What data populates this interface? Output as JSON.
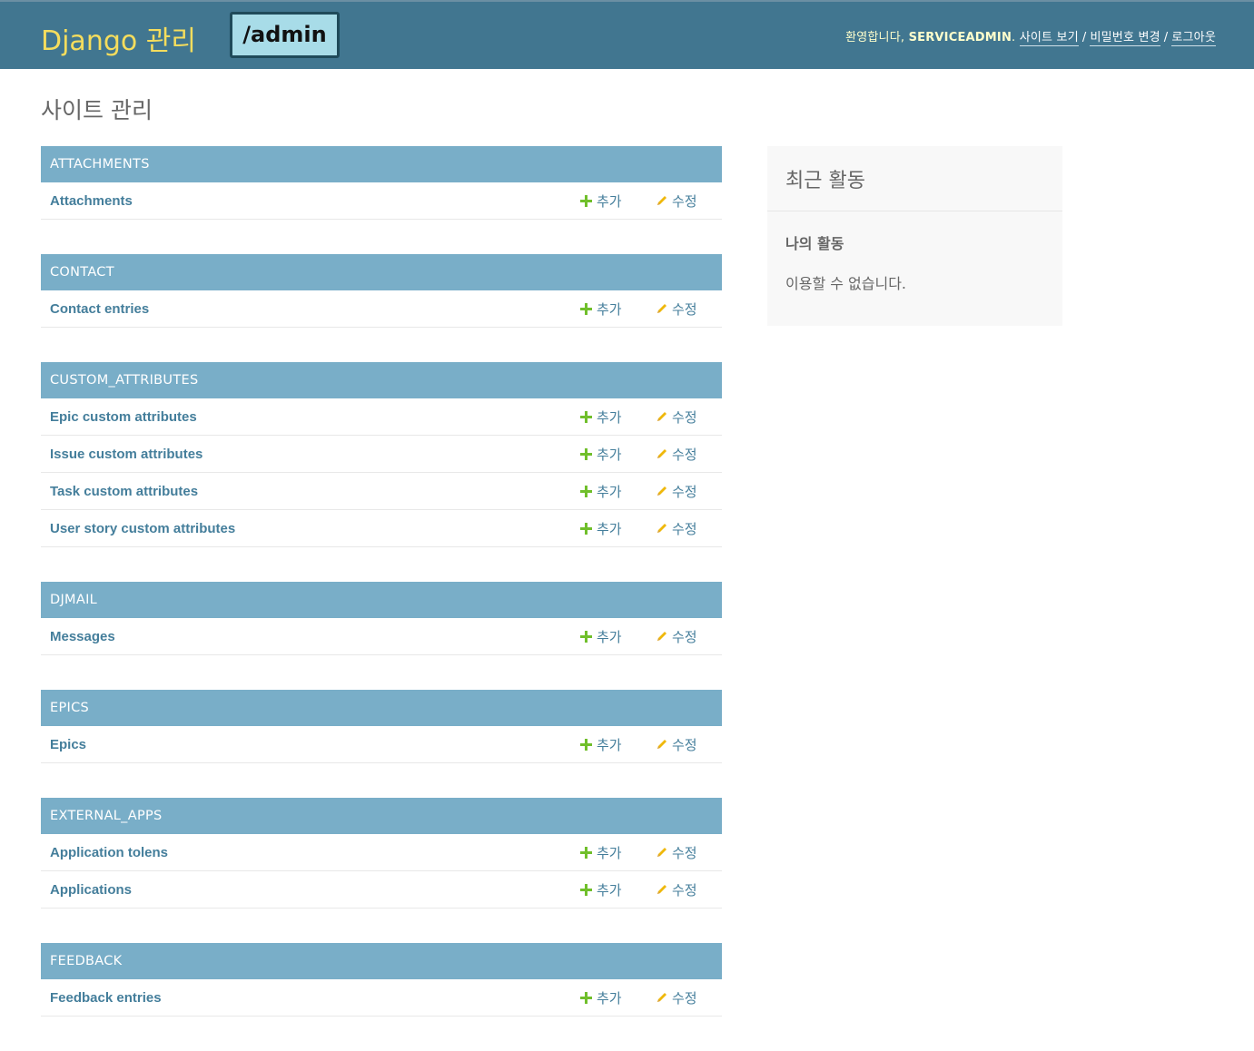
{
  "header": {
    "branding": "Django 관리",
    "annotation_tag": "/admin",
    "user_tools": {
      "welcome": "환영합니다,",
      "username": "SERVICEADMIN",
      "username_suffix": ".",
      "view_site": "사이트 보기",
      "change_password": "비밀번호 변경",
      "logout": "로그아웃",
      "separator": "/"
    }
  },
  "page_title": "사이트 관리",
  "labels": {
    "add": "추가",
    "change": "수정"
  },
  "modules": [
    {
      "caption": "ATTACHMENTS",
      "models": [
        "Attachments"
      ]
    },
    {
      "caption": "CONTACT",
      "models": [
        "Contact entries"
      ]
    },
    {
      "caption": "CUSTOM_ATTRIBUTES",
      "models": [
        "Epic custom attributes",
        "Issue custom attributes",
        "Task custom attributes",
        "User story custom attributes"
      ]
    },
    {
      "caption": "DJMAIL",
      "models": [
        "Messages"
      ]
    },
    {
      "caption": "EPICS",
      "models": [
        "Epics"
      ]
    },
    {
      "caption": "EXTERNAL_APPS",
      "models": [
        "Application tolens",
        "Applications"
      ]
    },
    {
      "caption": "FEEDBACK",
      "models": [
        "Feedback entries"
      ]
    }
  ],
  "recent_actions": {
    "title": "최근 활동",
    "my_actions": "나의 활동",
    "none_available": "이용할 수 없습니다."
  },
  "colors": {
    "header_bg": "#417690",
    "branding": "#f5dd5d",
    "module_caption_bg": "#79aec8",
    "link": "#447e9b",
    "add_icon": "#70bf2b",
    "change_icon": "#efb80b"
  }
}
